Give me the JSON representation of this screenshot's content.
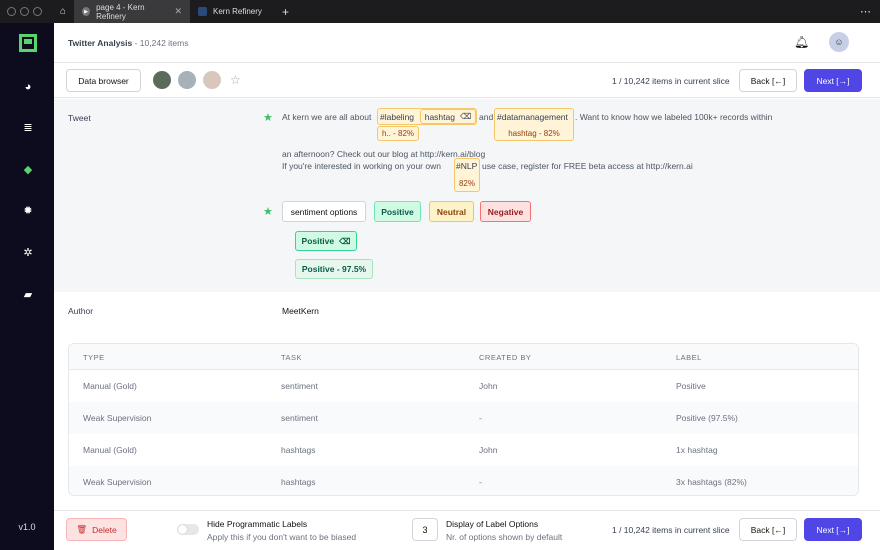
{
  "browser": {
    "tabs": [
      {
        "label": "page 4 - Kern Refinery",
        "close": "✕"
      },
      {
        "label": "Kern Refinery"
      }
    ],
    "new_tab": "+",
    "menu": "⋯"
  },
  "sidebar": {
    "version": "v1.0"
  },
  "header": {
    "project": "Twitter Analysis",
    "count": " - 10,242 items"
  },
  "toolbar": {
    "data_browser": "Data browser",
    "slice_info": "1 / 10,242 items in current slice",
    "back": "Back [←]",
    "next": "Next [→]"
  },
  "record": {
    "tweet_label": "Tweet",
    "text_1_pre": "At kern we are all about",
    "hl_labeling": "#labeling",
    "chip_hashtag": "hashtag",
    "text_and": "and",
    "hl_datamanagement": "#datamanagement",
    "text_1_post": ". Want to know how we labeled 100k+ records within",
    "label_h82": "h.. - 82%",
    "label_hashtag82": "hashtag - 82%",
    "text_2": "an afternoon? Check out our blog at http://kern.ai/blog",
    "text_3_pre": "If you're interested in working on your own",
    "hl_nlp": "#NLP",
    "text_3_post": "use case, register for FREE beta access at http://kern.ai",
    "label_82": "82%",
    "sentiment_options": "sentiment options",
    "opt_positive": "Positive",
    "opt_neutral": "Neutral",
    "opt_negative": "Negative",
    "selected_positive": "Positive",
    "weak_positive": "Positive - 97.5%",
    "author_label": "Author",
    "author_value": "MeetKern"
  },
  "table": {
    "headers": [
      "TYPE",
      "TASK",
      "CREATED BY",
      "LABEL"
    ],
    "rows": [
      [
        "Manual (Gold)",
        "sentiment",
        "John",
        "Positive"
      ],
      [
        "Weak Supervision",
        "sentiment",
        "-",
        "Positive (97.5%)"
      ],
      [
        "Manual (Gold)",
        "hashtags",
        "John",
        "1x hashtag"
      ],
      [
        "Weak Supervision",
        "hashtags",
        "-",
        "3x hashtags (82%)"
      ]
    ]
  },
  "footer": {
    "delete": "Delete",
    "hide_title": "Hide Programmatic Labels",
    "hide_sub": "Apply this if you don't want to be biased",
    "options_value": "3",
    "options_title": "Display of Label Options",
    "options_sub": "Nr. of options shown by default",
    "slice_info": "1 / 10,242 items in current slice",
    "back": "Back [←]",
    "next": "Next [→]"
  }
}
